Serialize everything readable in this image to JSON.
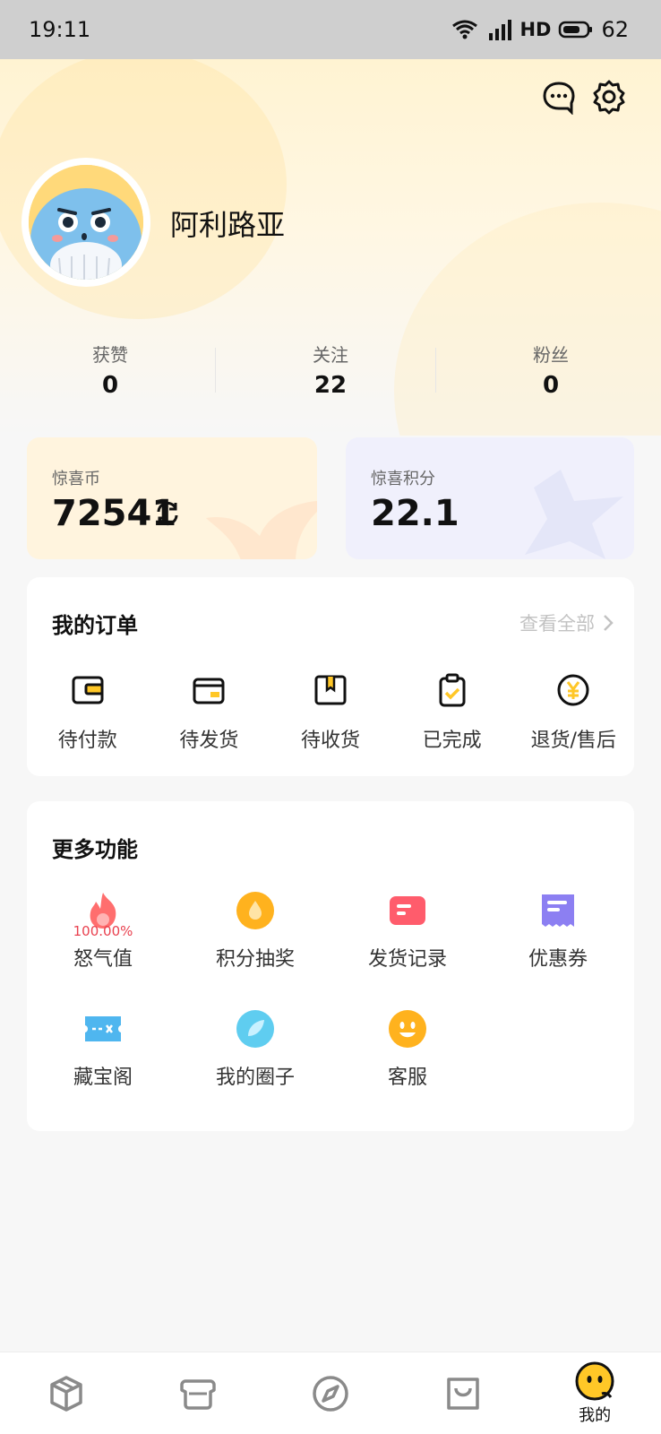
{
  "status_bar": {
    "time": "19:11",
    "network": "HD",
    "battery": "62"
  },
  "header": {
    "icons": [
      "message-icon",
      "settings-icon"
    ],
    "username": "阿利路亚"
  },
  "stats": [
    {
      "label": "获赞",
      "value": "0"
    },
    {
      "label": "关注",
      "value": "22"
    },
    {
      "label": "粉丝",
      "value": "0"
    }
  ],
  "wallet": {
    "coin": {
      "label": "惊喜币",
      "value": "72541"
    },
    "points": {
      "label": "惊喜积分",
      "value": "22.1"
    }
  },
  "orders": {
    "title": "我的订单",
    "view_all": "查看全部",
    "items": [
      {
        "label": "待付款",
        "icon": "wallet-icon"
      },
      {
        "label": "待发货",
        "icon": "box-icon"
      },
      {
        "label": "待收货",
        "icon": "package-icon"
      },
      {
        "label": "已完成",
        "icon": "clipboard-check-icon"
      },
      {
        "label": "退货/售后",
        "icon": "yen-icon"
      }
    ]
  },
  "features": {
    "title": "更多功能",
    "items": [
      {
        "label": "怒气值",
        "icon": "flame-icon",
        "badge": "100.00%"
      },
      {
        "label": "积分抽奖",
        "icon": "drop-icon"
      },
      {
        "label": "发货记录",
        "icon": "record-icon"
      },
      {
        "label": "优惠券",
        "icon": "coupon-icon"
      },
      {
        "label": "藏宝阁",
        "icon": "ticket-icon"
      },
      {
        "label": "我的圈子",
        "icon": "circle-leaf-icon"
      },
      {
        "label": "客服",
        "icon": "smiley-icon"
      }
    ]
  },
  "bottom_nav": {
    "items": [
      {
        "label": "",
        "icon": "cube-icon"
      },
      {
        "label": "",
        "icon": "capsule-icon"
      },
      {
        "label": "",
        "icon": "compass-icon"
      },
      {
        "label": "",
        "icon": "bag-icon"
      },
      {
        "label": "我的",
        "icon": "profile-face-icon",
        "active": true
      }
    ]
  },
  "colors": {
    "accent": "#ffc727",
    "coin_card": "#fff4de",
    "points_card": "#f0f0fc",
    "badge_red": "#e9414f"
  }
}
